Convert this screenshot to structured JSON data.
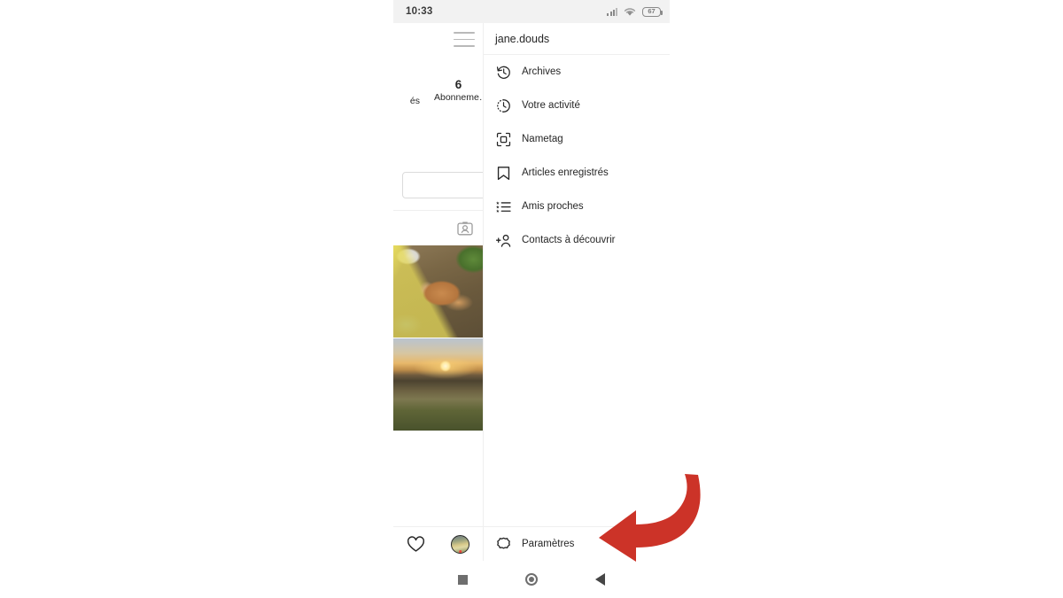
{
  "status_bar": {
    "time": "10:33",
    "battery_level": "67",
    "signal_icon": "cellular-signal-icon",
    "wifi_icon": "wifi-icon",
    "battery_icon": "battery-icon"
  },
  "profile": {
    "menu_icon": "hamburger-menu-icon",
    "stats": [
      {
        "count": "",
        "label": "és",
        "name": "followers-stat-partial"
      },
      {
        "count": "6",
        "label": "Abonneme…",
        "name": "following-stat"
      }
    ],
    "edit_profile_button": "",
    "tabs": [
      {
        "icon": "tagged-photos-icon",
        "name": "tab-tagged"
      }
    ],
    "grid_photos": [
      {
        "name": "photo-dog",
        "alt": "dog lying on ground"
      },
      {
        "name": "photo-sunset",
        "alt": "sunset over hills"
      }
    ]
  },
  "drawer": {
    "username": "jane.douds",
    "items": [
      {
        "label": "Archives",
        "icon": "archive-clock-icon"
      },
      {
        "label": "Votre activité",
        "icon": "activity-clock-icon"
      },
      {
        "label": "Nametag",
        "icon": "nametag-icon"
      },
      {
        "label": "Articles enregistrés",
        "icon": "bookmark-icon"
      },
      {
        "label": "Amis proches",
        "icon": "close-friends-list-icon"
      },
      {
        "label": "Contacts à découvrir",
        "icon": "discover-people-icon"
      }
    ],
    "settings": {
      "label": "Paramètres",
      "icon": "settings-gear-icon"
    }
  },
  "app_nav": {
    "items": [
      {
        "icon": "heart-icon",
        "name": "nav-activity"
      },
      {
        "icon": "profile-avatar-icon",
        "name": "nav-profile"
      }
    ]
  },
  "system_nav": {
    "items": [
      {
        "icon": "recents-square-icon",
        "name": "system-nav-recents"
      },
      {
        "icon": "home-circle-icon",
        "name": "system-nav-home"
      },
      {
        "icon": "back-triangle-icon",
        "name": "system-nav-back"
      }
    ]
  },
  "annotation": {
    "arrow_icon": "red-curved-arrow",
    "arrow_color": "#cc3328",
    "points_to": "Paramètres"
  }
}
